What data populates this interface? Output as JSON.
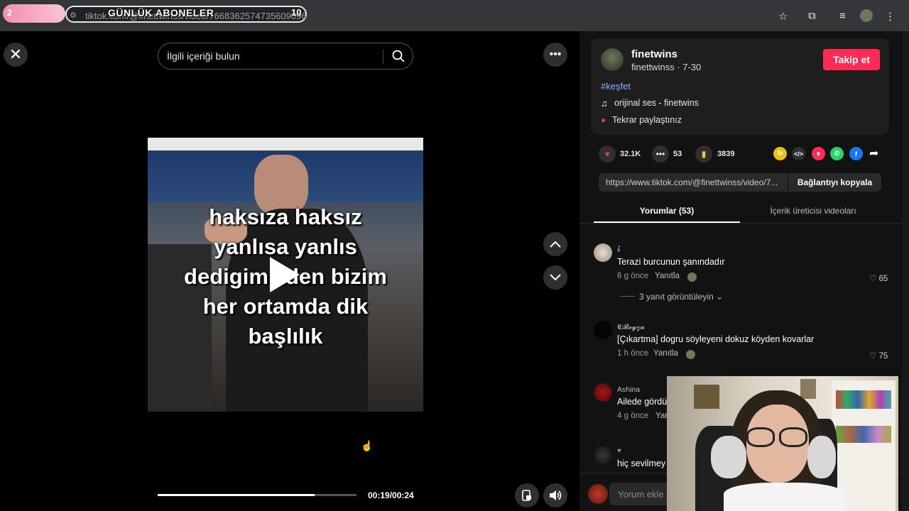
{
  "browser": {
    "url": "tiktok.com/@finettwinss/video/7668362574735609096",
    "banner_text": "GÜNLÜK ABONELER",
    "banner_count": "10",
    "tab_badge": "2"
  },
  "video": {
    "search_placeholder": "İlgili içeriği bulun",
    "caption_lines": [
      "haksıza haksız",
      "yanlısa yanlıs",
      "dedigimizden  bizim",
      "her ortamda dik",
      "başlılık"
    ],
    "time": "00:19/00:24",
    "progress": 0.79
  },
  "creator": {
    "name": "finetwins",
    "handle_date": "finettwinss · 7-30",
    "follow_label": "Takip et",
    "hashtag": "#keşfet",
    "music": "orijinal ses - finetwins",
    "repost": "Tekrar paylaştınız"
  },
  "stats": {
    "likes": "32.1K",
    "comments": "53",
    "saves": "3839"
  },
  "share": {
    "link": "https://www.tiktok.com/@finettwinss/video/7...",
    "copy_label": "Bağlantıyı kopyala"
  },
  "tabs": {
    "comments": "Yorumlar (53)",
    "creator_videos": "İçerik üreticisi videoları"
  },
  "comments": [
    {
      "user": "ءُ",
      "text": "Terazi burcunun şanındadır",
      "time": "6 g önce",
      "reply": "Yanıtla",
      "likes": "65",
      "view_replies": "3 yanıt görüntüleyin"
    },
    {
      "user": "𝕮𝓑𝓮𝔂𝔃𝓪",
      "text": "[Çıkartma] dogru söyleyeni dokuz köyden kovarlar",
      "time": "1 h önce",
      "reply": "Yanıtla",
      "likes": "75"
    },
    {
      "user": "Ashina",
      "text": "Ailede gördü",
      "time": "4 g önce",
      "reply": "Yan"
    },
    {
      "user": "",
      "text": "hiç sevilmey"
    }
  ],
  "comment_input_placeholder": "Yorum ekle"
}
